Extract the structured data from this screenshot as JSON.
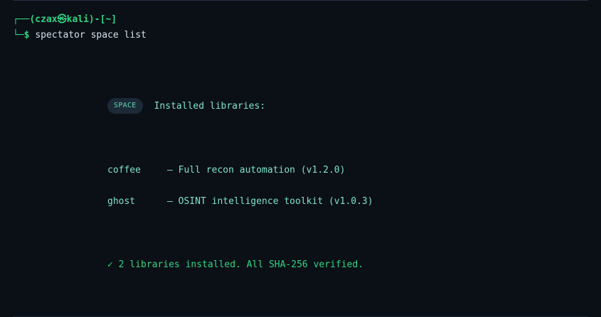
{
  "prompt": {
    "corner_top": "┌──",
    "user_host": "(czax㉿kali)",
    "sep": "-",
    "cwd": "[~]",
    "corner_bottom": "└─",
    "symbol": "$",
    "command": "spectator space list"
  },
  "header": {
    "badge": "SPACE",
    "title": "Installed libraries:"
  },
  "libraries": [
    {
      "name": "coffee",
      "description": "– Full recon automation (v1.2.0)"
    },
    {
      "name": "ghost",
      "description": "– OSINT intelligence toolkit (v1.0.3)"
    }
  ],
  "summary": {
    "check": "✓",
    "text": "2 libraries installed. All SHA-256 verified."
  },
  "colors": {
    "background": "#0b0f16",
    "accent_green": "#2fd584",
    "teal_text": "#7fe3c9",
    "badge_bg": "#1c2a38"
  }
}
